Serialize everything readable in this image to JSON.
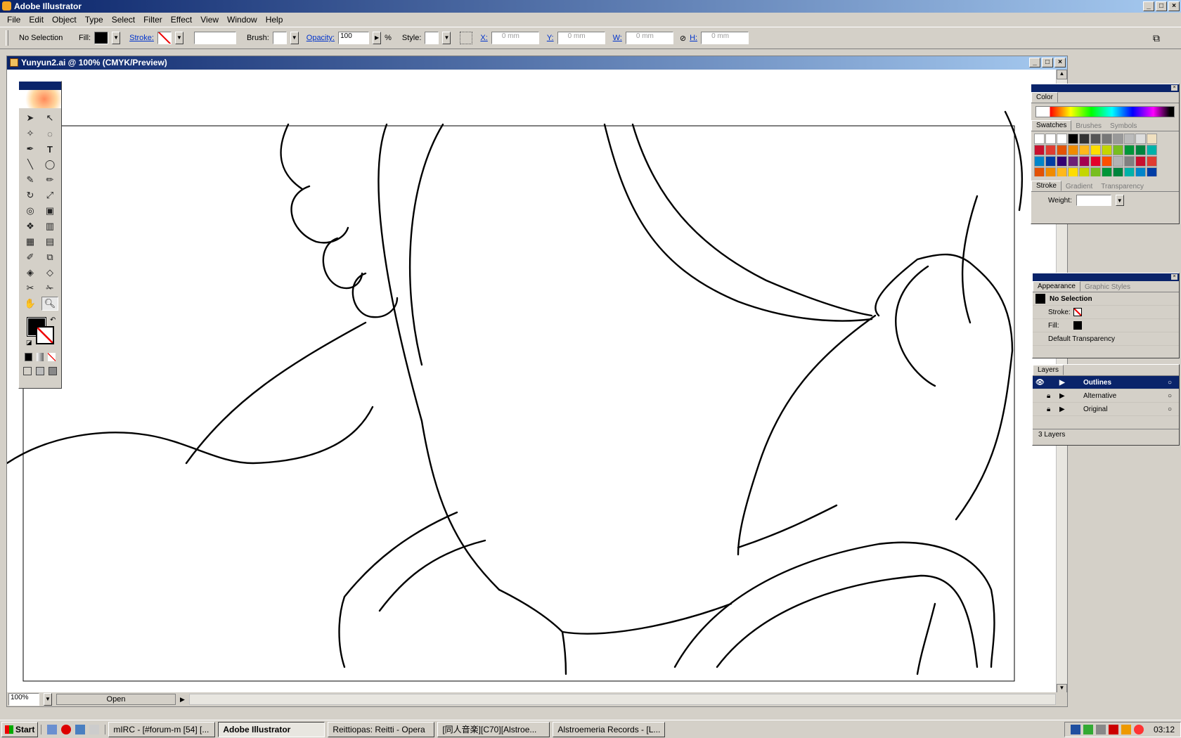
{
  "app": {
    "title": "Adobe Illustrator"
  },
  "menu": [
    "File",
    "Edit",
    "Object",
    "Type",
    "Select",
    "Filter",
    "Effect",
    "View",
    "Window",
    "Help"
  ],
  "control": {
    "selection": "No Selection",
    "fill": "Fill:",
    "stroke": "Stroke:",
    "brush": "Brush:",
    "opacity": "Opacity:",
    "opacity_value": "100",
    "percent": "%",
    "style": "Style:",
    "x": "X:",
    "x_value": "0 mm",
    "y": "Y:",
    "y_value": "0 mm",
    "w": "W:",
    "w_value": "0 mm",
    "h": "H:",
    "h_value": "0 mm"
  },
  "document": {
    "title": "Yunyun2.ai @ 100% (CMYK/Preview)",
    "zoom": "100%",
    "status": "Open"
  },
  "color_panel": {
    "tab": "Color"
  },
  "swatches_panel": {
    "tabs": [
      "Swatches",
      "Brushes",
      "Symbols"
    ],
    "colors": [
      "#c8102e",
      "#e03c31",
      "#e35205",
      "#f08b00",
      "#ffb81c",
      "#fedd00",
      "#c4d600",
      "#78be20",
      "#009639",
      "#00843d",
      "#00b2a9",
      "#0085ca",
      "#003da5",
      "#330072",
      "#6d2077",
      "#a50050",
      "#e4002b",
      "#fe5000",
      "#b3b3b3",
      "#808080"
    ]
  },
  "stroke_panel": {
    "tabs": [
      "Stroke",
      "Gradient",
      "Transparency"
    ],
    "weight_label": "Weight:"
  },
  "appearance_panel": {
    "tabs": [
      "Appearance",
      "Graphic Styles"
    ],
    "header": "No Selection",
    "stroke": "Stroke:",
    "fill": "Fill:",
    "transparency": "Default Transparency"
  },
  "layers_panel": {
    "tab": "Layers",
    "layers": [
      "Outlines",
      "Alternative",
      "Original"
    ],
    "count": "3 Layers"
  },
  "taskbar": {
    "start": "Start",
    "items": [
      "mIRC - [#forum-m [54] [...",
      "Adobe Illustrator",
      "Reittiopas: Reitti - Opera",
      "[同人音楽][C70][Alstroe...",
      "Alstroemeria Records - [L..."
    ],
    "clock": "03:12"
  },
  "colors": {
    "titlebar": "#0a246a",
    "accent": "#a6caf0"
  }
}
